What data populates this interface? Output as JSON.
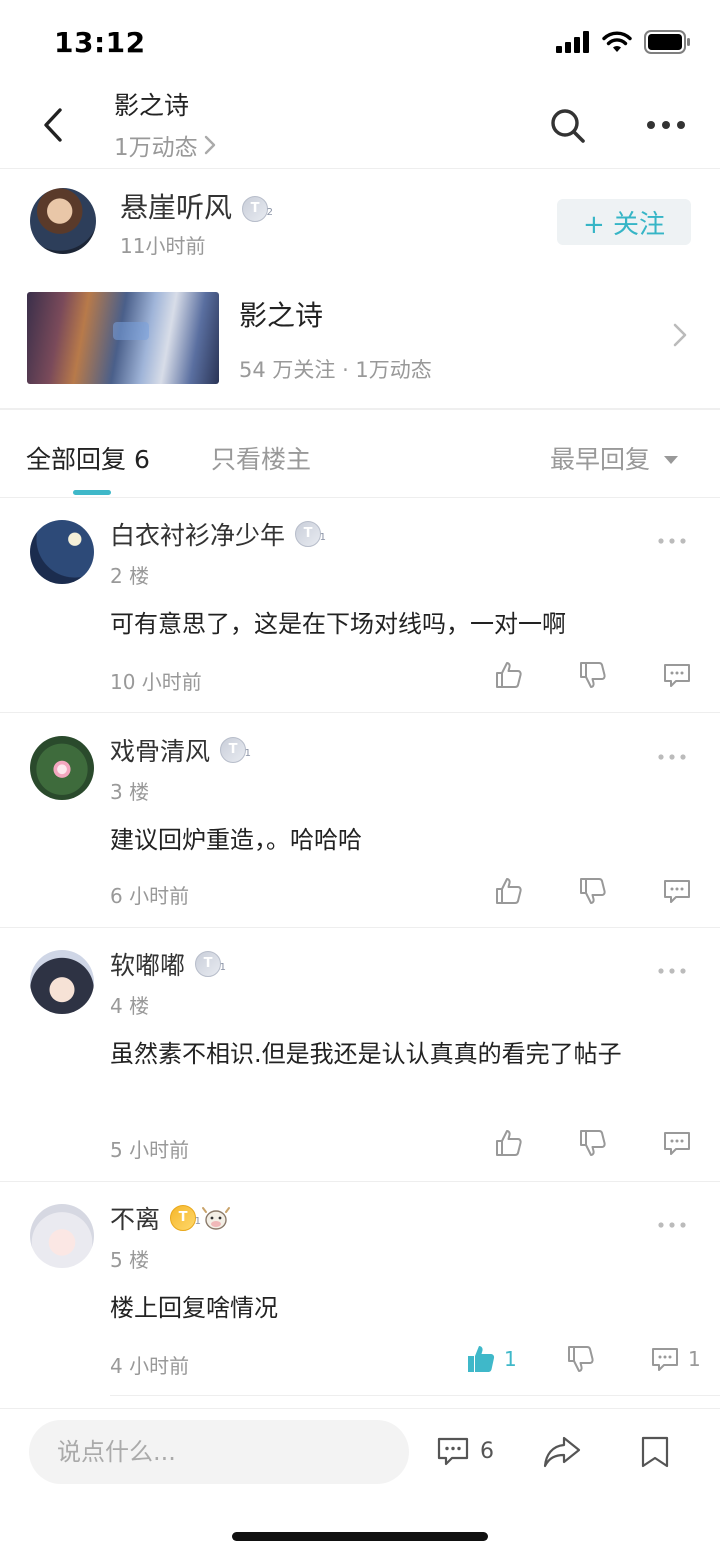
{
  "status": {
    "time": "13:12"
  },
  "nav": {
    "title": "影之诗",
    "subtitle": "1万动态"
  },
  "author": {
    "name": "悬崖听风",
    "level": "2",
    "time": "11小时前",
    "follow_label": "+ 关注"
  },
  "forum": {
    "name": "影之诗",
    "stats": "54 万关注 · 1万动态"
  },
  "tabs": {
    "all_label": "全部回复 6",
    "op_only_label": "只看楼主",
    "sort_label": "最早回复"
  },
  "comments": [
    {
      "name": "白衣衬衫净少年",
      "level": "1",
      "floor": "2 楼",
      "text": "可有意思了，这是在下场对线吗，一对一啊",
      "time": "10 小时前",
      "likes": "",
      "replies": ""
    },
    {
      "name": "戏骨清风",
      "level": "1",
      "floor": "3 楼",
      "text": "建议回炉重造，。哈哈哈",
      "time": "6 小时前",
      "likes": "",
      "replies": ""
    },
    {
      "name": "软嘟嘟",
      "level": "1",
      "floor": "4 楼",
      "text": "虽然素不相识.但是我还是认认真真的看完了帖子",
      "time": "5 小时前",
      "likes": "",
      "replies": ""
    },
    {
      "name": "不离",
      "level": "1",
      "floor": "5 楼",
      "text": "楼上回复啥情况",
      "time": "4 小时前",
      "likes": "1",
      "replies": "1"
    }
  ],
  "bottom": {
    "placeholder": "说点什么...",
    "comment_count": "6"
  },
  "colors": {
    "accent": "#3fb8c9",
    "muted": "#999999"
  }
}
